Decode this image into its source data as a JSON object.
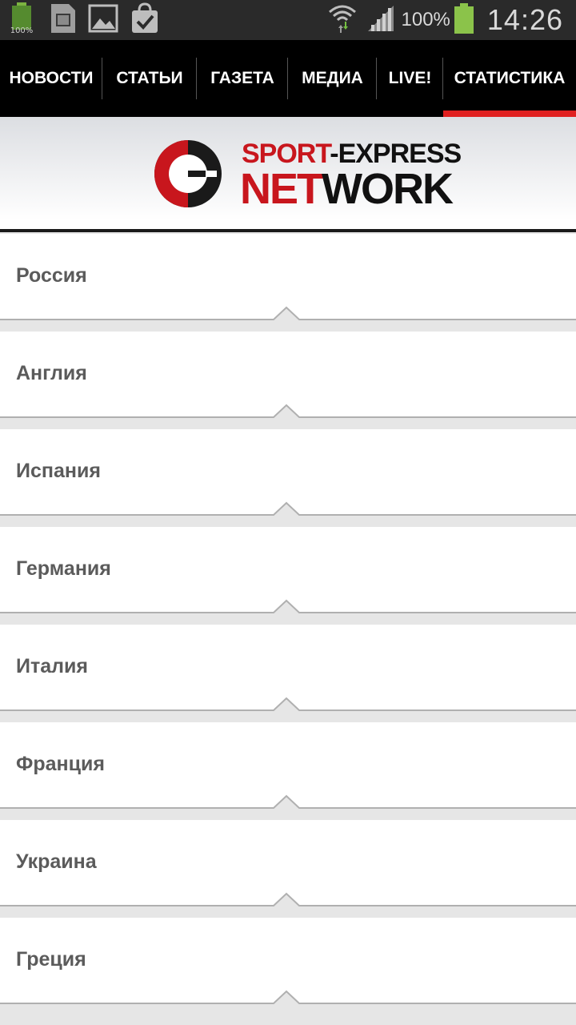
{
  "status_bar": {
    "battery_mini_label": "100%",
    "battery_percent": "100%",
    "time": "14:26",
    "icons": [
      "battery-widget-icon",
      "sim-card-icon",
      "gallery-icon",
      "shopping-bag-check-icon",
      "wifi-icon",
      "signal-icon",
      "battery-icon"
    ]
  },
  "nav": {
    "tabs": [
      {
        "label": "НОВОСТИ"
      },
      {
        "label": "СТАТЬИ"
      },
      {
        "label": "ГАЗЕТА"
      },
      {
        "label": "МЕДИА"
      },
      {
        "label": "LIVE!"
      },
      {
        "label": "СТАТИСТИКА"
      }
    ],
    "active_tab": "СТАТИСТИКА"
  },
  "brand": {
    "line1_red": "SPORT",
    "line1_dark": "-EXPRESS",
    "line2_red": "NET",
    "line2_dark": "WORK",
    "colors": {
      "red": "#c8161d",
      "dark": "#111111"
    }
  },
  "countries": [
    {
      "label": "Россия"
    },
    {
      "label": "Англия"
    },
    {
      "label": "Испания"
    },
    {
      "label": "Германия"
    },
    {
      "label": "Италия"
    },
    {
      "label": "Франция"
    },
    {
      "label": "Украина"
    },
    {
      "label": "Греция"
    }
  ],
  "colors": {
    "accent": "#e02020",
    "nav_background": "#000000",
    "list_text": "#5b5b5b"
  }
}
